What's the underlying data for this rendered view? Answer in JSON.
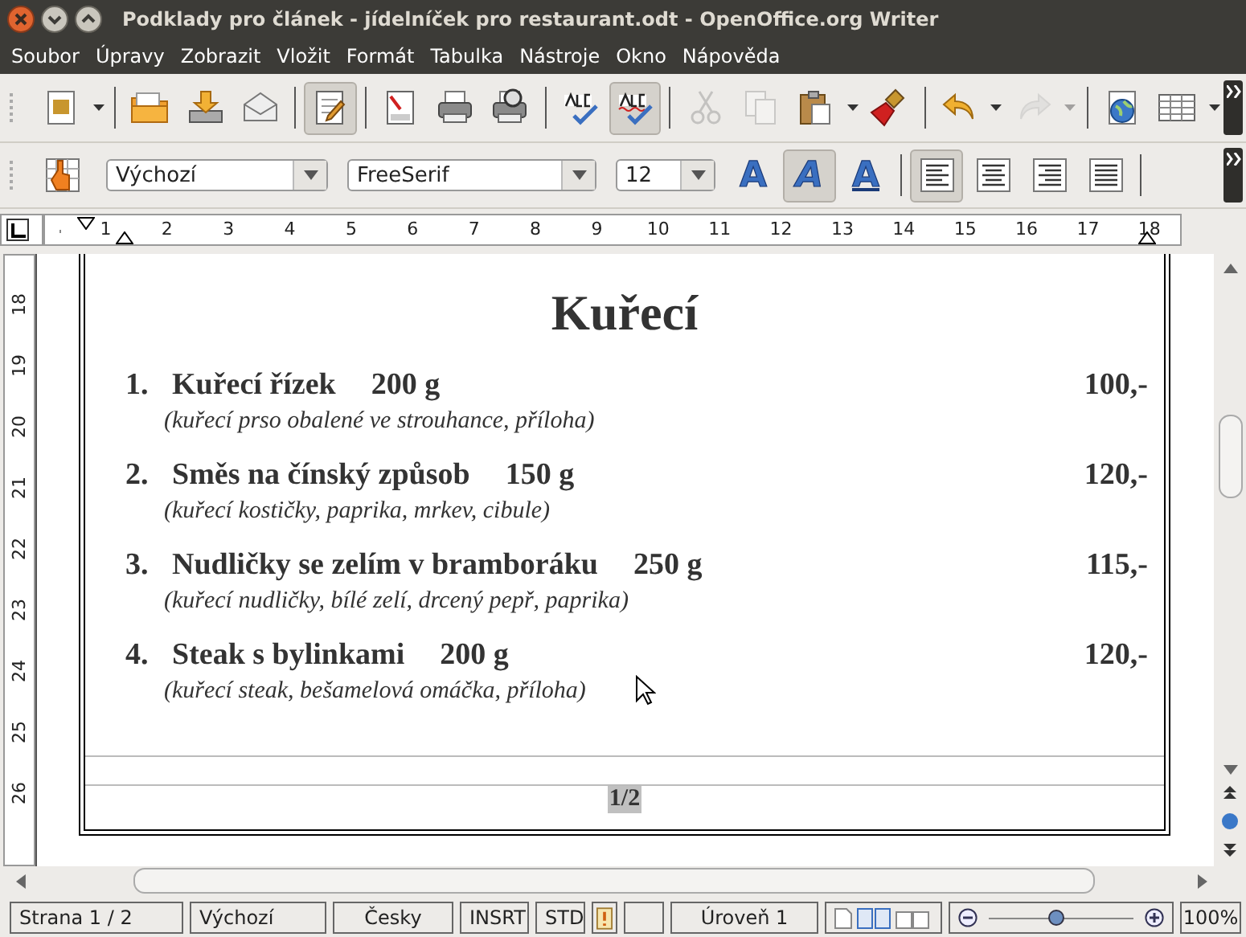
{
  "window": {
    "title": "Podklady pro článek - jídelníček pro restaurant.odt - OpenOffice.org Writer"
  },
  "menu": [
    "Soubor",
    "Úpravy",
    "Zobrazit",
    "Vložit",
    "Formát",
    "Tabulka",
    "Nástroje",
    "Okno",
    "Nápověda"
  ],
  "toolbar": [
    {
      "kind": "new",
      "selected": false,
      "disabled": false,
      "dropdown": true
    },
    {
      "kind": "sep"
    },
    {
      "kind": "open",
      "selected": false,
      "disabled": false,
      "dropdown": false
    },
    {
      "kind": "save",
      "selected": false,
      "disabled": false,
      "dropdown": false
    },
    {
      "kind": "mail",
      "selected": false,
      "disabled": false,
      "dropdown": false
    },
    {
      "kind": "sep"
    },
    {
      "kind": "edit",
      "selected": true,
      "disabled": false,
      "dropdown": false
    },
    {
      "kind": "sep"
    },
    {
      "kind": "pdf",
      "selected": false,
      "disabled": false,
      "dropdown": false
    },
    {
      "kind": "print",
      "selected": false,
      "disabled": false,
      "dropdown": false
    },
    {
      "kind": "preview",
      "selected": false,
      "disabled": false,
      "dropdown": false
    },
    {
      "kind": "sep"
    },
    {
      "kind": "spell",
      "selected": false,
      "disabled": false,
      "dropdown": false
    },
    {
      "kind": "autospell",
      "selected": true,
      "disabled": false,
      "dropdown": false
    },
    {
      "kind": "sep"
    },
    {
      "kind": "cut",
      "selected": false,
      "disabled": true,
      "dropdown": false
    },
    {
      "kind": "copy",
      "selected": false,
      "disabled": true,
      "dropdown": false
    },
    {
      "kind": "paste",
      "selected": false,
      "disabled": false,
      "dropdown": true
    },
    {
      "kind": "brush",
      "selected": false,
      "disabled": false,
      "dropdown": false
    },
    {
      "kind": "sep"
    },
    {
      "kind": "undo",
      "selected": false,
      "disabled": false,
      "dropdown": true
    },
    {
      "kind": "redo",
      "selected": false,
      "disabled": true,
      "dropdown": true
    },
    {
      "kind": "sep"
    },
    {
      "kind": "globe",
      "selected": false,
      "disabled": false,
      "dropdown": false
    },
    {
      "kind": "table",
      "selected": false,
      "disabled": false,
      "dropdown": true
    }
  ],
  "format_bar": {
    "paragraph_style": "Výchozí",
    "font": "FreeSerif",
    "size": "12",
    "text_buttons": [
      {
        "kind": "bold",
        "label": "A",
        "selected": false
      },
      {
        "kind": "italic",
        "label": "A",
        "selected": true
      },
      {
        "kind": "underline",
        "label": "A",
        "selected": false
      }
    ],
    "align_buttons": [
      {
        "kind": "left",
        "selected": true
      },
      {
        "kind": "center",
        "selected": false
      },
      {
        "kind": "right",
        "selected": false
      },
      {
        "kind": "justify",
        "selected": false
      }
    ]
  },
  "ruler": {
    "horizontal": [
      "1",
      "2",
      "3",
      "4",
      "5",
      "6",
      "7",
      "8",
      "9",
      "10",
      "11",
      "12",
      "13",
      "14",
      "15",
      "16",
      "17",
      "18"
    ],
    "vertical": [
      "18",
      "19",
      "20",
      "21",
      "22",
      "23",
      "24",
      "25",
      "26"
    ]
  },
  "document": {
    "heading": "Kuřecí",
    "items": [
      {
        "number": "1.",
        "name": "Kuřecí řízek",
        "weight": "200 g",
        "price": "100,-",
        "description": "(kuřecí prso obalené ve strouhance, příloha)"
      },
      {
        "number": "2.",
        "name": "Směs na čínský způsob",
        "weight": "150 g",
        "price": "120,-",
        "description": "(kuřecí kostičky, paprika, mrkev, cibule)"
      },
      {
        "number": "3.",
        "name": "Nudličky se zelím v bramboráku",
        "weight": "250 g",
        "price": "115,-",
        "description": "(kuřecí nudličky, bílé zelí, drcený pepř, paprika)"
      },
      {
        "number": "4.",
        "name": "Steak s bylinkami",
        "weight": "200 g",
        "price": "120,-",
        "description": "(kuřecí steak, bešamelová omáčka, příloha)"
      }
    ],
    "footer": "1/2"
  },
  "status_bar": {
    "page": "Strana 1 / 2",
    "style": "Výchozí",
    "language": "Česky",
    "insert_mode": "INSRT",
    "selection_mode": "STD",
    "modified": true,
    "outline": "Úroveň 1",
    "zoom": {
      "level": 0.47,
      "reading": "100%"
    }
  }
}
